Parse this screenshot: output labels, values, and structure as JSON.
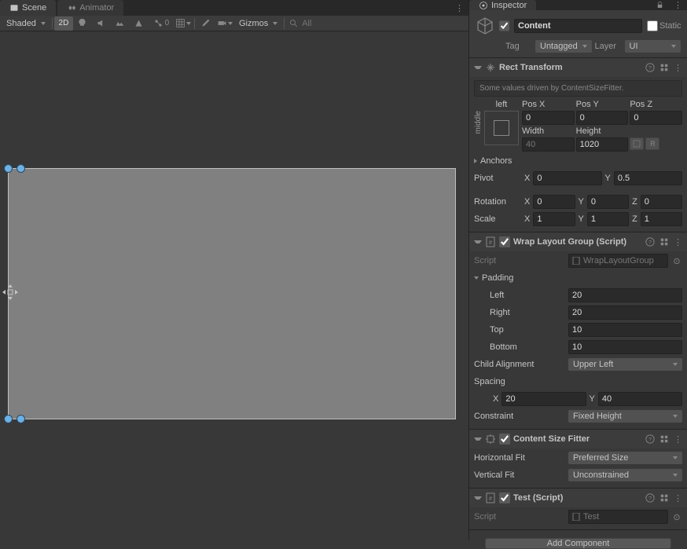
{
  "tabs": {
    "scene": "Scene",
    "animator": "Animator",
    "inspector": "Inspector"
  },
  "sceneToolbar": {
    "shadingMode": "Shaded",
    "mode2D": "2D",
    "debugCount": "0",
    "gizmos": "Gizmos",
    "searchPlaceholder": "All"
  },
  "gameObject": {
    "enabled": true,
    "name": "Content",
    "staticLabel": "Static",
    "tagLabel": "Tag",
    "tag": "Untagged",
    "layerLabel": "Layer",
    "layer": "UI"
  },
  "rectTransform": {
    "title": "Rect Transform",
    "hint": "Some values driven by ContentSizeFitter.",
    "anchorTopLabel": "left",
    "anchorSideLabel": "middle",
    "posXLabel": "Pos X",
    "posX": "0",
    "posYLabel": "Pos Y",
    "posY": "0",
    "posZLabel": "Pos Z",
    "posZ": "0",
    "widthLabel": "Width",
    "width": "40",
    "heightLabel": "Height",
    "height": "1020",
    "anchorsLabel": "Anchors",
    "pivotLabel": "Pivot",
    "pivotX": "0",
    "pivotY": "0.5",
    "rotationLabel": "Rotation",
    "rotX": "0",
    "rotY": "0",
    "rotZ": "0",
    "scaleLabel": "Scale",
    "scaleX": "1",
    "scaleY": "1",
    "scaleZ": "1",
    "blueprintBtn": "⊡",
    "rawBtn": "R"
  },
  "wrapLayout": {
    "title": "Wrap Layout Group (Script)",
    "scriptLabel": "Script",
    "scriptValue": "WrapLayoutGroup",
    "paddingLabel": "Padding",
    "leftLabel": "Left",
    "left": "20",
    "rightLabel": "Right",
    "right": "20",
    "topLabel": "Top",
    "top": "10",
    "bottomLabel": "Bottom",
    "bottom": "10",
    "childAlignLabel": "Child Alignment",
    "childAlign": "Upper Left",
    "spacingLabel": "Spacing",
    "spacingX": "20",
    "spacingY": "40",
    "constraintLabel": "Constraint",
    "constraint": "Fixed Height"
  },
  "contentSizeFitter": {
    "title": "Content Size Fitter",
    "horizLabel": "Horizontal Fit",
    "horiz": "Preferred Size",
    "vertLabel": "Vertical Fit",
    "vert": "Unconstrained"
  },
  "testScript": {
    "title": "Test (Script)",
    "scriptLabel": "Script",
    "scriptValue": "Test"
  },
  "addComponent": "Add Component",
  "axes": {
    "x": "X",
    "y": "Y",
    "z": "Z"
  }
}
